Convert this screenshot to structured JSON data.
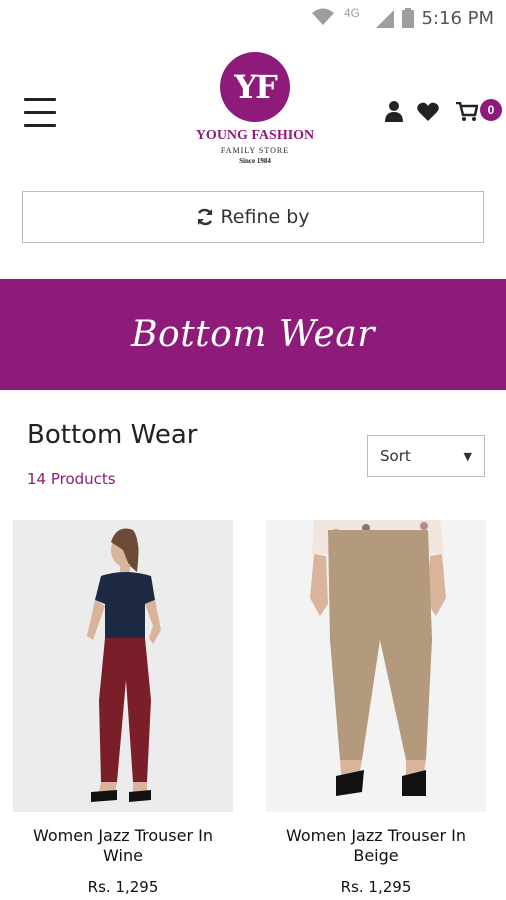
{
  "status_bar": {
    "time": "5:16 PM",
    "network": "4G"
  },
  "header": {
    "logo_initials": "YF",
    "brand_name": "YOUNG FASHION",
    "brand_sub": "FAMILY STORE",
    "brand_since": "Since 1984",
    "cart_count": "0"
  },
  "refine": {
    "label": "Refine by"
  },
  "banner": {
    "title": "Bottom Wear"
  },
  "category": {
    "title": "Bottom Wear",
    "product_count": "14 Products",
    "sort_label": "Sort"
  },
  "products": [
    {
      "title": "Women Jazz Trouser In Wine",
      "price": "Rs. 1,295"
    },
    {
      "title": "Women Jazz Trouser In Beige",
      "price": "Rs. 1,295"
    }
  ],
  "colors": {
    "brand": "#8e1a7a",
    "wine": "#7a1f2a",
    "beige": "#b39a7c"
  }
}
